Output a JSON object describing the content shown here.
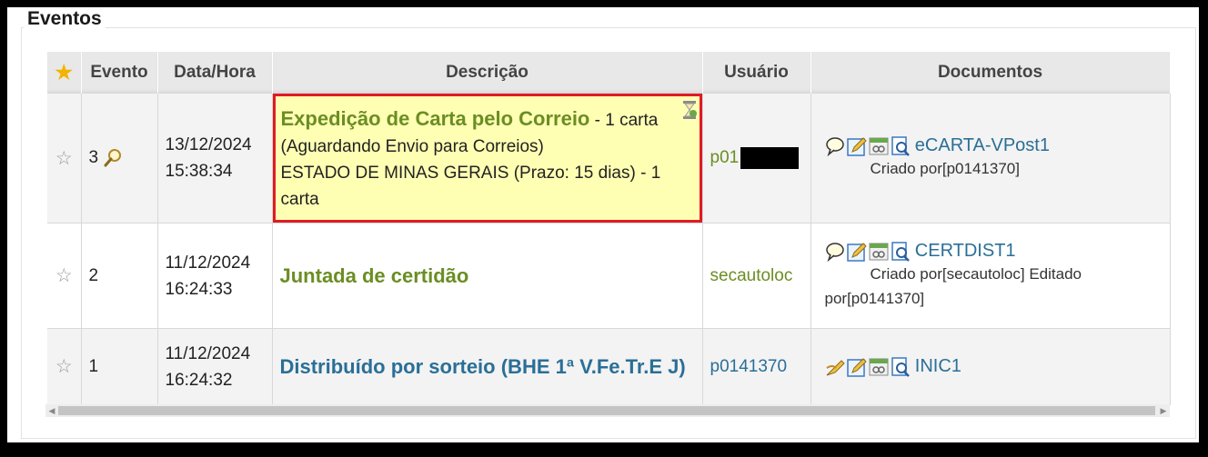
{
  "section_title": "Eventos",
  "columns": {
    "evento": "Evento",
    "datahora": "Data/Hora",
    "descricao": "Descrição",
    "usuario": "Usuário",
    "documentos": "Documentos"
  },
  "rows": [
    {
      "evento": "3",
      "date": "13/12/2024",
      "time": "15:38:34",
      "title": "Expedição de Carta pelo Correio",
      "detail1": " - 1 carta",
      "detail2": "(Aguardando Envio para Correios)",
      "detail3": "ESTADO DE MINAS GERAIS (Prazo: 15 dias) - 1 carta",
      "user": "p01",
      "doc_name": "eCARTA-VPost1",
      "doc_meta": "Criado por[p0141370]"
    },
    {
      "evento": "2",
      "date": "11/12/2024",
      "time": "16:24:33",
      "title": "Juntada de certidão",
      "user": "secautoloc",
      "doc_name": "CERTDIST1",
      "doc_meta1": "Criado por[secautoloc] Editado",
      "doc_meta2": "por[p0141370]"
    },
    {
      "evento": "1",
      "date": "11/12/2024",
      "time": "16:24:32",
      "title": "Distribuído por sorteio (BHE 1ª V.Fe.Tr.E J)",
      "user": "p0141370",
      "doc_name": "INIC1"
    }
  ],
  "icons": {
    "header_star": "star-icon",
    "row_star": "star-outline-icon",
    "magnifier": "magnifier-icon",
    "speech": "speech-bubble-icon",
    "edit": "edit-icon",
    "link": "link-icon",
    "view": "view-document-icon",
    "sign": "sign-icon",
    "hourglass": "hourglass-icon"
  },
  "colors": {
    "highlight_bg": "#ffffb4",
    "highlight_border": "#e01b24",
    "title_green": "#6b8e23",
    "title_blue": "#2a6f97"
  }
}
